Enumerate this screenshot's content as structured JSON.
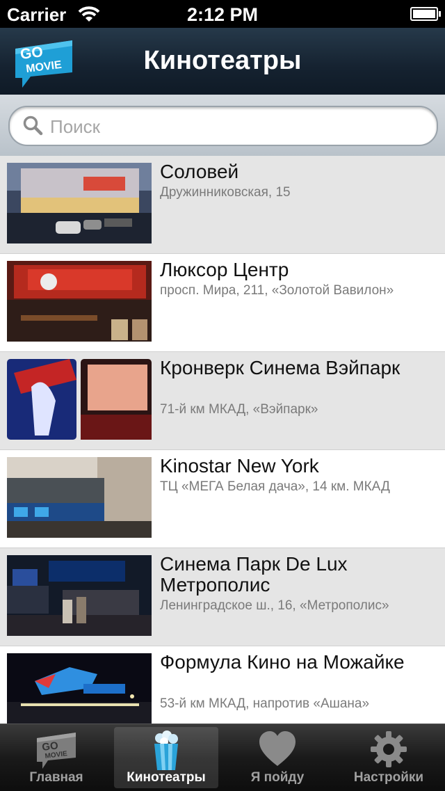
{
  "status_bar": {
    "carrier": "Carrier",
    "time": "2:12 PM"
  },
  "nav": {
    "logo_text_top": "GO",
    "logo_text_bottom": "MOVIE",
    "title": "Кинотеатры"
  },
  "search": {
    "placeholder": "Поиск",
    "value": ""
  },
  "cinemas": [
    {
      "name": "Соловей",
      "address": "Дружинниковская, 15"
    },
    {
      "name": "Люксор Центр",
      "address": "просп. Мира, 211, «Золотой Вавилон»"
    },
    {
      "name": "Кронверк Синема Вэйпарк",
      "address": "71-й км МКАД, «Вэйпарк»"
    },
    {
      "name": "Kinostar New York",
      "address": "ТЦ «МЕГА Белая дача», 14 км. МКАД"
    },
    {
      "name": "Синема Парк De Lux Метрополис",
      "address": "Ленинградское ш., 16, «Метрополис»"
    },
    {
      "name": "Формула Кино на Можайке",
      "address": "53-й км МКАД, напротив «Ашана»"
    }
  ],
  "tabs": [
    {
      "label": "Главная",
      "icon": "gomovie-icon",
      "active": false
    },
    {
      "label": "Кинотеатры",
      "icon": "popcorn-icon",
      "active": true
    },
    {
      "label": "Я пойду",
      "icon": "heart-icon",
      "active": false
    },
    {
      "label": "Настройки",
      "icon": "gear-icon",
      "active": false
    }
  ],
  "colors": {
    "nav_bg": "#1b2a38",
    "accent": "#2aa3d9",
    "list_odd": "#e5e5e5",
    "list_even": "#ffffff"
  }
}
